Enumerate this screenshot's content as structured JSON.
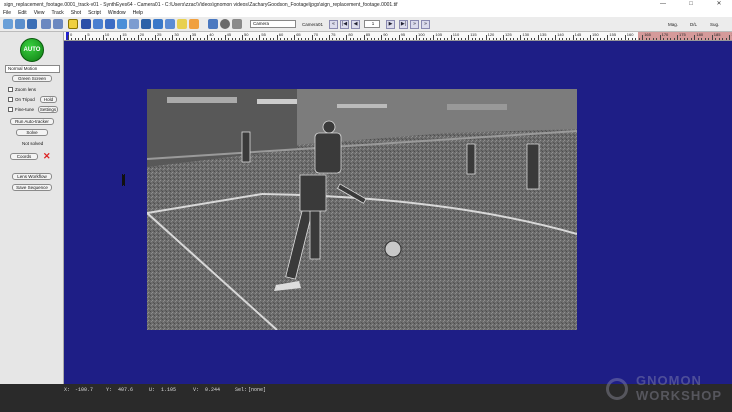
{
  "window": {
    "title": "sign_replacement_footage.0001_track-v01 - SynthEyes64 - Camera01 - C:\\Users\\zzac\\Videos\\gnomon videos\\ZacharyGoodson_Footage\\jpgs\\sign_replacement_footage.0001.tif",
    "min": "—",
    "max": "□",
    "close": "✕"
  },
  "menu": [
    "File",
    "Edit",
    "View",
    "Track",
    "Shot",
    "Script",
    "Window",
    "Help"
  ],
  "toolbar": {
    "camera_select": "Camera",
    "camera_name": "Camera01",
    "frame_value": "1",
    "right_labels": [
      "Mag.",
      "D/L",
      "Sug."
    ]
  },
  "ruler": {
    "labels": [
      "0",
      "5",
      "10",
      "15",
      "20",
      "25",
      "30",
      "35",
      "40",
      "45",
      "50",
      "55",
      "60",
      "65",
      "70",
      "75",
      "80",
      "85",
      "90",
      "95",
      "100",
      "105",
      "110",
      "115",
      "120",
      "125",
      "130",
      "135",
      "140",
      "145",
      "150",
      "155",
      "160",
      "165",
      "170",
      "175",
      "180",
      "185",
      "190"
    ]
  },
  "sidebar": {
    "auto_label": "AUTO",
    "preset": "Normal Motion",
    "green_screen": "Green Screen",
    "zoom_lens": "Zoom lens",
    "on_tripod": "On Tripod",
    "hold": "Hold",
    "fine_tune": "Fine-tune",
    "settings": "Settings",
    "run_auto": "Run Auto-tracker",
    "solve": "Solve",
    "not_solved": "Not solved",
    "coords": "Coords",
    "lens_workflow": "Lens Workflow",
    "save_sequence": "Save Sequence"
  },
  "status": {
    "x_label": "X:",
    "x": "-100.7",
    "y_label": "Y:",
    "y": "407.6",
    "u_label": "U:",
    "u": "1.105",
    "v_label": "V:",
    "v": "0.244",
    "sel_label": "Sel:",
    "sel": "[none]"
  },
  "watermark": {
    "line1": "GNOMON",
    "line2": "WORKSHOP"
  },
  "colors": {
    "viewport": "#1e1e86",
    "accent_auto": "#1ea523",
    "ruler_red": "#d59a9a"
  }
}
